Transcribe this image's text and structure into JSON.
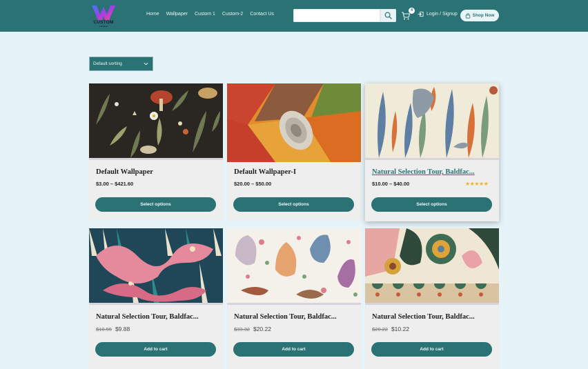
{
  "header": {
    "logo": {
      "text": "CUSTOM",
      "subtext": "wallpaper"
    },
    "nav": [
      "Home",
      "Wallpaper",
      "Custom 1",
      "Custom-2",
      "Contact Us"
    ],
    "search": {
      "value": "",
      "placeholder": ""
    },
    "cart_count": "4",
    "login_label": "Login / Signup",
    "shop_now_label": "Shop Now"
  },
  "sort": {
    "selected": "Default sorting"
  },
  "products": [
    {
      "title": "Default Wallpaper",
      "price": "$3.00 – $421.60",
      "old_price": "",
      "new_price": "",
      "rating": "",
      "button": "Select options",
      "pattern": "dark-botanical"
    },
    {
      "title": "Default Wallpaper-I",
      "price": "$20.00 – $50.00",
      "old_price": "",
      "new_price": "",
      "rating": "",
      "button": "Select options",
      "pattern": "fabric-roll"
    },
    {
      "title": "Natural Selection Tour, Baldfac...",
      "price": "$10.00 – $40.00",
      "old_price": "",
      "new_price": "",
      "rating": "★★★★★",
      "button": "Select options",
      "pattern": "heron-leaves"
    },
    {
      "title": "Natural Selection Tour, Baldfac...",
      "price": "",
      "old_price": "$10.55",
      "new_price": "$9.88",
      "rating": "",
      "button": "Add to cart",
      "pattern": "pink-dragon"
    },
    {
      "title": "Natural Selection Tour, Baldfac...",
      "price": "",
      "old_price": "$33.32",
      "new_price": "$20.22",
      "rating": "",
      "button": "Add to cart",
      "pattern": "floral-animals"
    },
    {
      "title": "Natural Selection Tour, Baldfac...",
      "price": "",
      "old_price": "$20.22",
      "new_price": "$10.22",
      "rating": "",
      "button": "Add to cart",
      "pattern": "folk-flowers"
    }
  ],
  "colors": {
    "primary": "#2b7275",
    "background": "#e6f4f9",
    "card": "#eeeeee",
    "star": "#f2b01e"
  },
  "icons": [
    "search-icon",
    "cart-icon",
    "login-icon",
    "shop-bag-icon",
    "chevron-down-icon"
  ]
}
